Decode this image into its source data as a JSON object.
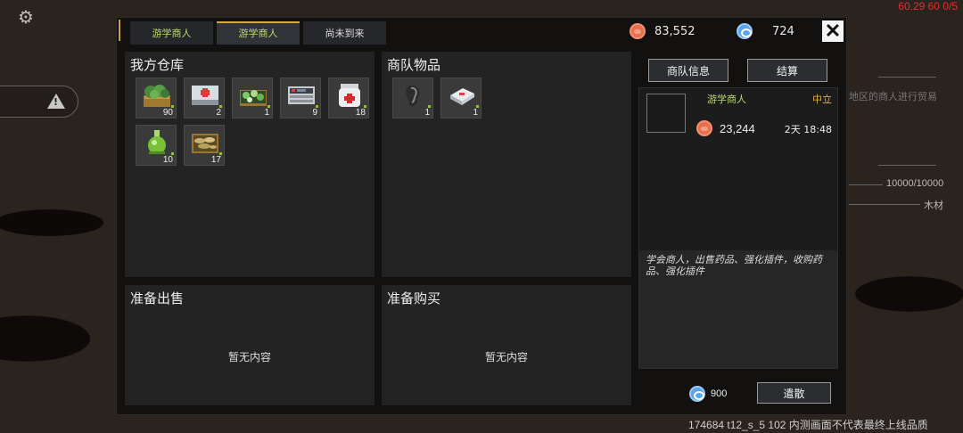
{
  "hud": {
    "fps": "60.29 60 0/5",
    "side_hp": "10000/10000",
    "side_wood": "木材",
    "side_text": "地区的商人进行贸易",
    "watermark": "174684 t12_s_5 102  内测画面不代表最终上线品质"
  },
  "tabs": [
    {
      "label": "游学商人",
      "state": "normal",
      "color": "green"
    },
    {
      "label": "游学商人",
      "state": "active",
      "color": "green"
    },
    {
      "label": "尚未到来",
      "state": "normal",
      "color": "white"
    }
  ],
  "currency": {
    "coins": "83,552",
    "gems": "724"
  },
  "panels": {
    "my_warehouse": {
      "title": "我方仓库",
      "items": [
        {
          "icon": "green-herb-crate-icon",
          "count": "90"
        },
        {
          "icon": "medkit-icon",
          "count": "2"
        },
        {
          "icon": "herb-seed-crate-icon",
          "count": "1"
        },
        {
          "icon": "device-panel-icon",
          "count": "9"
        },
        {
          "icon": "medicine-jar-icon",
          "count": "18"
        },
        {
          "icon": "green-potion-icon",
          "count": "10"
        },
        {
          "icon": "mushroom-crate-icon",
          "count": "17"
        }
      ]
    },
    "caravan_goods": {
      "title": "商队物品",
      "items": [
        {
          "icon": "ear-implant-icon",
          "count": "1"
        },
        {
          "icon": "plug-module-icon",
          "count": "1"
        }
      ]
    },
    "ready_to_sell": {
      "title": "准备出售",
      "empty": "暂无内容"
    },
    "ready_to_buy": {
      "title": "准备购买",
      "empty": "暂无内容"
    }
  },
  "sidebar": {
    "caravan_info_button": "商队信息",
    "settle_button": "结算",
    "merchant": {
      "name": "游学商人",
      "status": "中立",
      "money": "23,244",
      "time": "2天 18:48",
      "description": "学会商人，出售药品、强化插件，收购药品、强化插件"
    }
  },
  "bottom": {
    "gems": "900",
    "dismiss_button": "遣散"
  },
  "colors": {
    "accent_gold": "#d8a840",
    "merchant_green": "#b9d96f",
    "coin": "#e8704c",
    "gem": "#5aa4ea"
  }
}
